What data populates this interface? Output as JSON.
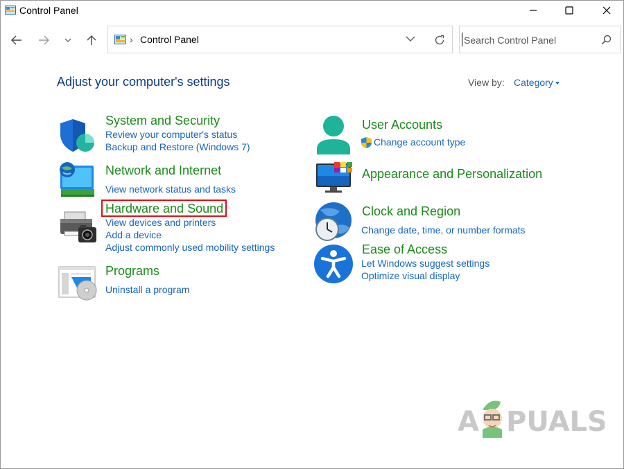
{
  "window": {
    "title": "Control Panel",
    "minimize_icon": "minimize-icon",
    "maximize_icon": "maximize-icon",
    "close_icon": "close-icon"
  },
  "navigation": {
    "back_icon": "back-arrow-icon",
    "forward_icon": "forward-arrow-icon",
    "recent_icon": "chevron-down-icon",
    "up_icon": "up-arrow-icon"
  },
  "address": {
    "path": "Control Panel",
    "separator": "›"
  },
  "search": {
    "placeholder": "Search Control Panel"
  },
  "main": {
    "heading": "Adjust your computer's settings",
    "view_by_label": "View by:",
    "view_by_value": "Category"
  },
  "categories": [
    {
      "title": "System and Security",
      "icon": "shield-icon",
      "links": [
        "Review your computer's status",
        "Backup and Restore (Windows 7)"
      ]
    },
    {
      "title": "Network and Internet",
      "icon": "network-icon",
      "links": [
        "View network status and tasks"
      ]
    },
    {
      "title": "Hardware and Sound",
      "icon": "printer-icon",
      "highlighted": true,
      "links": [
        "View devices and printers",
        "Add a device",
        "Adjust commonly used mobility settings"
      ]
    },
    {
      "title": "Programs",
      "icon": "programs-icon",
      "links": [
        "Uninstall a program"
      ]
    },
    {
      "title": "User Accounts",
      "icon": "user-icon",
      "links": [
        "Change account type"
      ],
      "link_icon": "uac-shield-icon"
    },
    {
      "title": "Appearance and Personalization",
      "icon": "monitor-icon",
      "links": []
    },
    {
      "title": "Clock and Region",
      "icon": "clock-globe-icon",
      "links": [
        "Change date, time, or number formats"
      ]
    },
    {
      "title": "Ease of Access",
      "icon": "accessibility-icon",
      "links": [
        "Let Windows suggest settings",
        "Optimize visual display"
      ]
    }
  ],
  "watermark": {
    "text_a": "A",
    "text_b": "PUALS"
  },
  "colors": {
    "heading": "#0a3a8c",
    "category_title": "#1a8a1a",
    "link": "#1565c0",
    "highlight_border": "#e01010"
  }
}
